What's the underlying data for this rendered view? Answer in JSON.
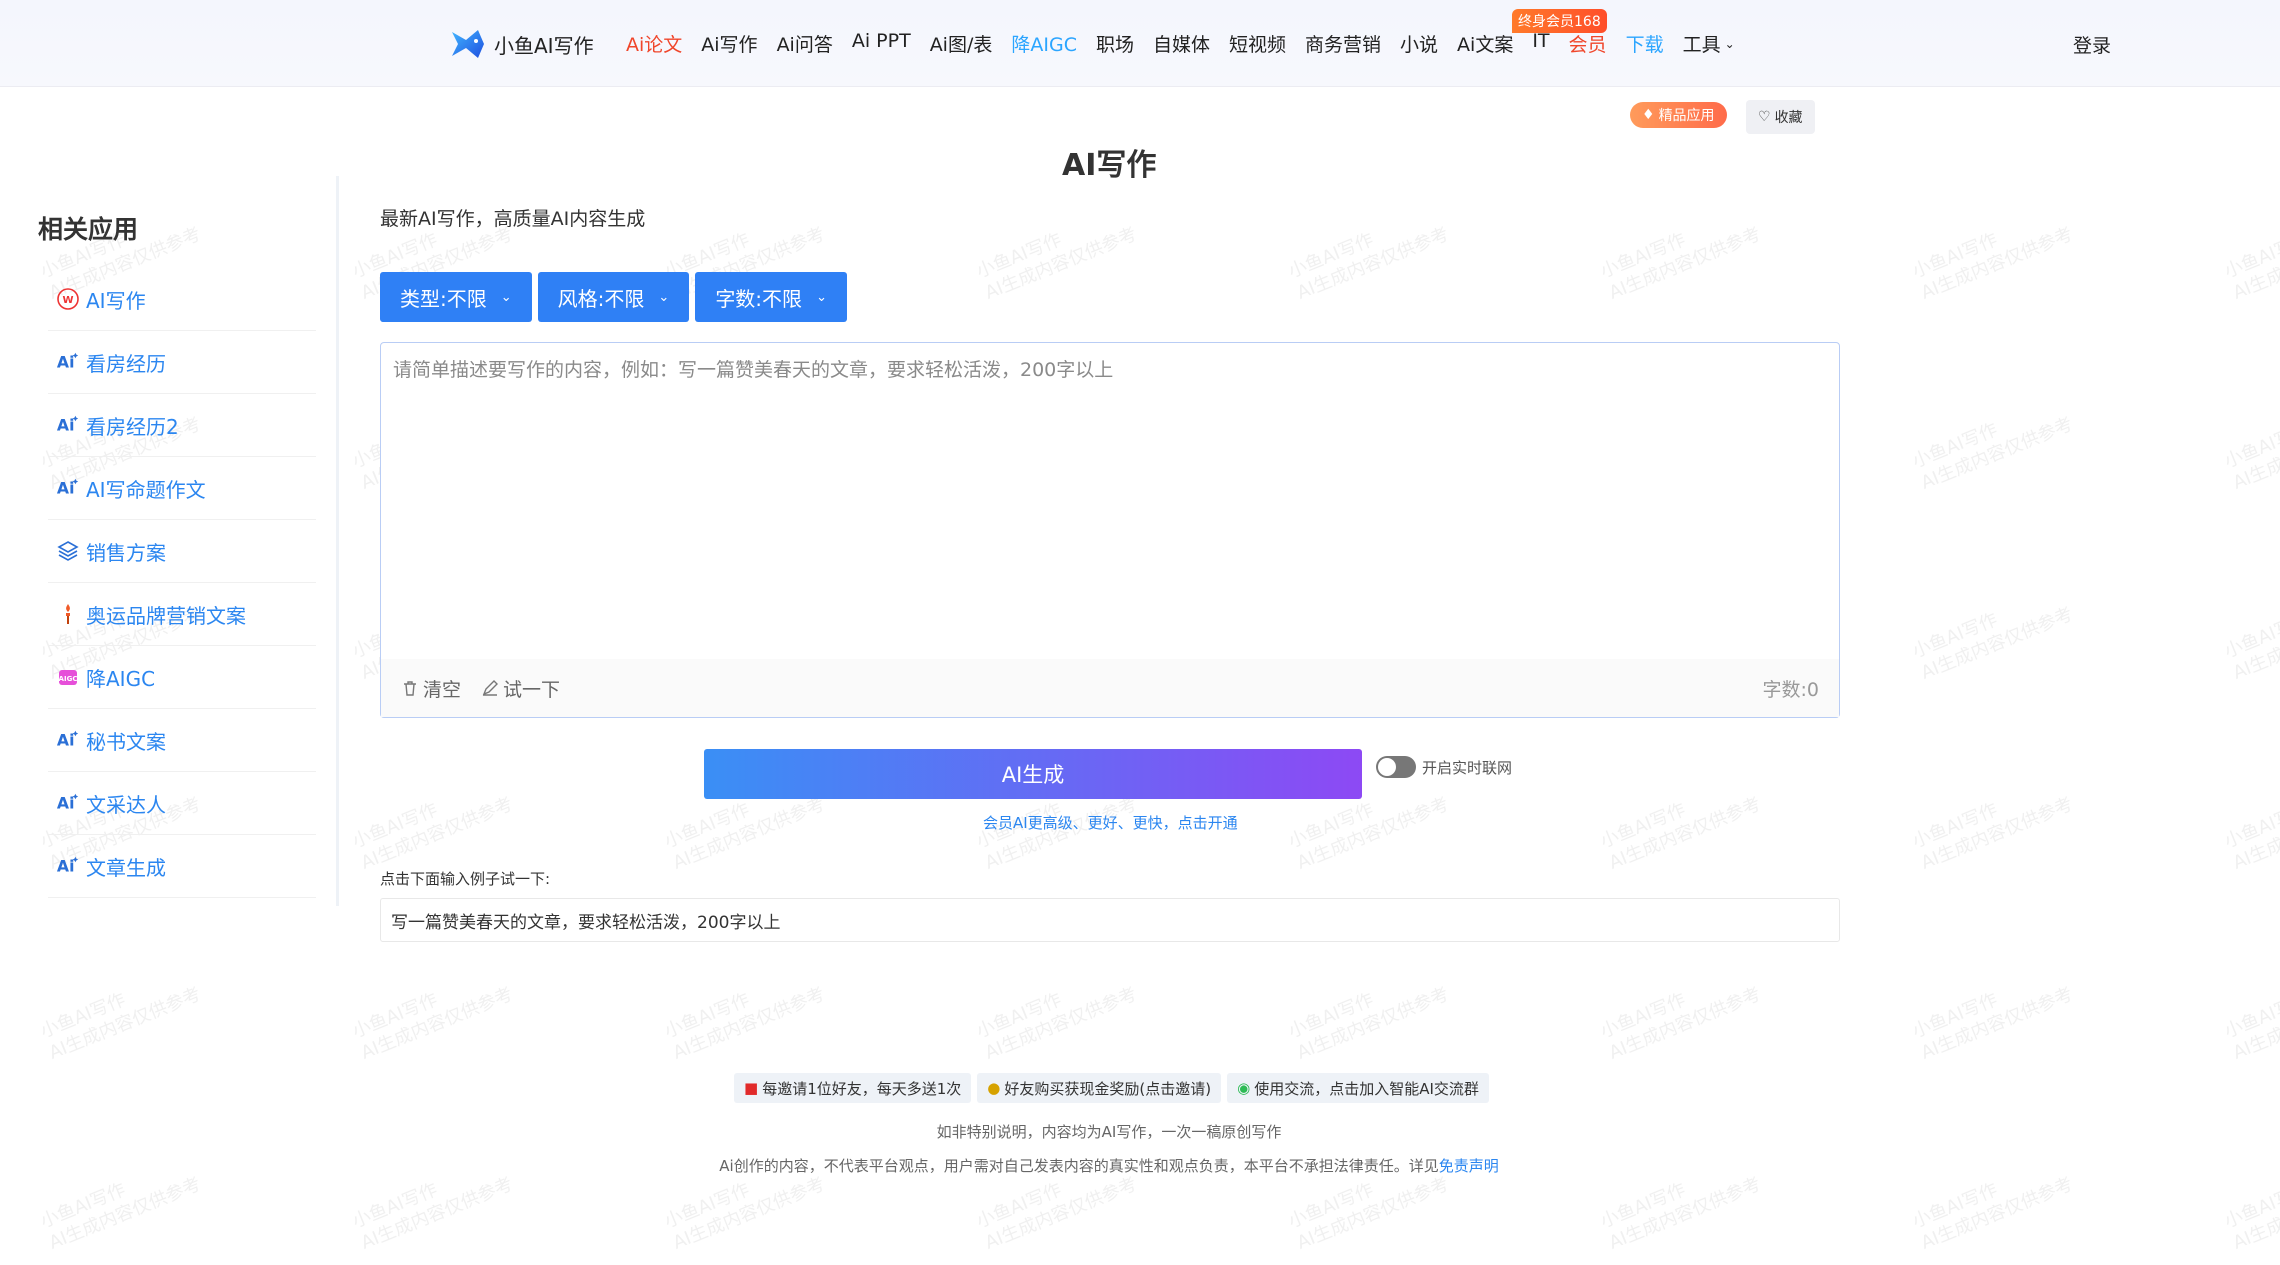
{
  "header": {
    "brand": "小鱼AI写作",
    "nav": [
      {
        "label": "Ai论文",
        "style": "red"
      },
      {
        "label": "Ai写作",
        "style": ""
      },
      {
        "label": "Ai问答",
        "style": ""
      },
      {
        "label": "Ai PPT",
        "style": ""
      },
      {
        "label": "Ai图/表",
        "style": ""
      },
      {
        "label": "降AIGC",
        "style": "blue"
      },
      {
        "label": "职场",
        "style": ""
      },
      {
        "label": "自媒体",
        "style": ""
      },
      {
        "label": "短视频",
        "style": ""
      },
      {
        "label": "商务营销",
        "style": ""
      },
      {
        "label": "小说",
        "style": ""
      },
      {
        "label": "Ai文案",
        "style": ""
      },
      {
        "label": "IT",
        "style": ""
      },
      {
        "label": "会员",
        "style": "red"
      },
      {
        "label": "下载",
        "style": "blue"
      }
    ],
    "tools_label": "工具",
    "vip_badge": "终身会员168",
    "login": "登录"
  },
  "actions": {
    "featured": "精品应用",
    "favorite": "收藏"
  },
  "page": {
    "title": "AI写作",
    "subtitle": "最新AI写作，高质量AI内容生成"
  },
  "sidebar": {
    "heading": "相关应用",
    "items": [
      {
        "label": "AI写作",
        "icon": "seal-icon"
      },
      {
        "label": "看房经历",
        "icon": "ai-icon"
      },
      {
        "label": "看房经历2",
        "icon": "ai-icon"
      },
      {
        "label": "AI写命题作文",
        "icon": "ai-icon"
      },
      {
        "label": "销售方案",
        "icon": "layers-icon"
      },
      {
        "label": "奥运品牌营销文案",
        "icon": "torch-icon"
      },
      {
        "label": "降AIGC",
        "icon": "aigc-icon"
      },
      {
        "label": "秘书文案",
        "icon": "ai-icon"
      },
      {
        "label": "文采达人",
        "icon": "ai-icon"
      },
      {
        "label": "文章生成",
        "icon": "ai-icon"
      }
    ]
  },
  "filters": {
    "type": "类型:不限",
    "style": "风格:不限",
    "length": "字数:不限"
  },
  "editor": {
    "placeholder": "请简单描述要写作的内容，例如：写一篇赞美春天的文章，要求轻松活泼，200字以上",
    "value": "",
    "clear": "清空",
    "try": "试一下",
    "word_count": "字数:0"
  },
  "generate": {
    "label": "AI生成",
    "online_toggle": "开启实时联网",
    "vip_tip": "会员AI更高级、更好、更快，点击开通"
  },
  "example": {
    "label": "点击下面输入例子试一下:",
    "text": "写一篇赞美春天的文章，要求轻松活泼，200字以上"
  },
  "footer": {
    "promos": [
      {
        "icon": "red-envelope-icon",
        "label": "每邀请1位好友，每天多送1次"
      },
      {
        "icon": "money-bag-icon",
        "label": "好友购买获现金奖励(点击邀请)"
      },
      {
        "icon": "wechat-icon",
        "label": "使用交流，点击加入智能AI交流群"
      }
    ],
    "line1": "如非特别说明，内容均为AI写作，一次一稿原创写作",
    "line2": "Ai创作的内容，不代表平台观点，用户需对自己发表内容的真实性和观点负责，本平台不承担法律责任。详见",
    "disclaimer_link": "免责声明"
  },
  "watermark": {
    "line1": "小鱼AI写作",
    "line2": "AI生成内容仅供参考"
  },
  "colors": {
    "primary": "#2f80f5",
    "nav_red": "#f0462b",
    "nav_blue": "#2ba5ff",
    "gradient_start": "#3a8ff5",
    "gradient_end": "#8d49f4"
  }
}
